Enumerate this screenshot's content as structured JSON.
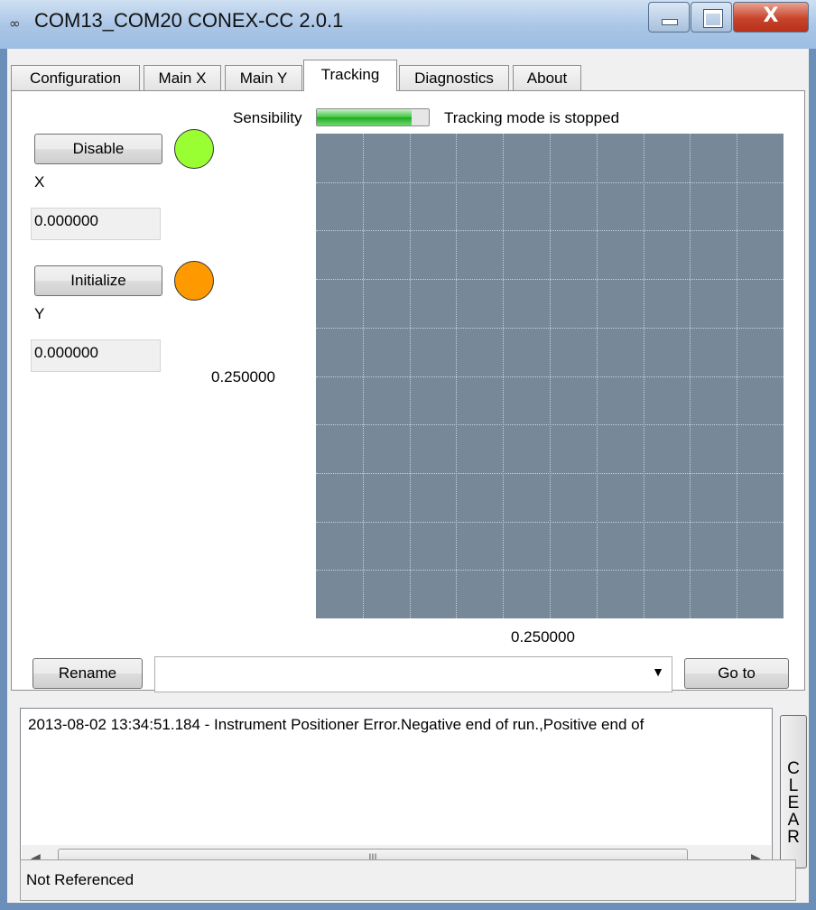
{
  "window": {
    "title": "COM13_COM20  CONEX-CC 2.0.1",
    "app_icon": "link-icon"
  },
  "tabs": [
    {
      "label": "Configuration"
    },
    {
      "label": "Main X"
    },
    {
      "label": "Main Y"
    },
    {
      "label": "Tracking",
      "active": true
    },
    {
      "label": "Diagnostics"
    },
    {
      "label": "About"
    }
  ],
  "tracking": {
    "disable_label": "Disable",
    "disable_led_color": "#99ff33",
    "x_label": "X",
    "x_value": "0.000000",
    "initialize_label": "Initialize",
    "initialize_led_color": "#ff9900",
    "y_label": "Y",
    "y_value": "0.000000",
    "sensibility_label": "Sensibility",
    "sensibility_level": 0.85,
    "status_text": "Tracking mode is stopped",
    "y_scale": "0.250000",
    "x_scale": "0.250000",
    "plot_color": "#778899"
  },
  "bottom": {
    "rename_label": "Rename",
    "combo_value": "",
    "goto_label": "Go to"
  },
  "log": {
    "lines": [
      "2013-08-02 13:34:51.184 - Instrument Positioner Error.Negative end of run.,Positive end of"
    ],
    "clear_label": "C L E A R"
  },
  "statusbar": {
    "text": "Not Referenced"
  }
}
